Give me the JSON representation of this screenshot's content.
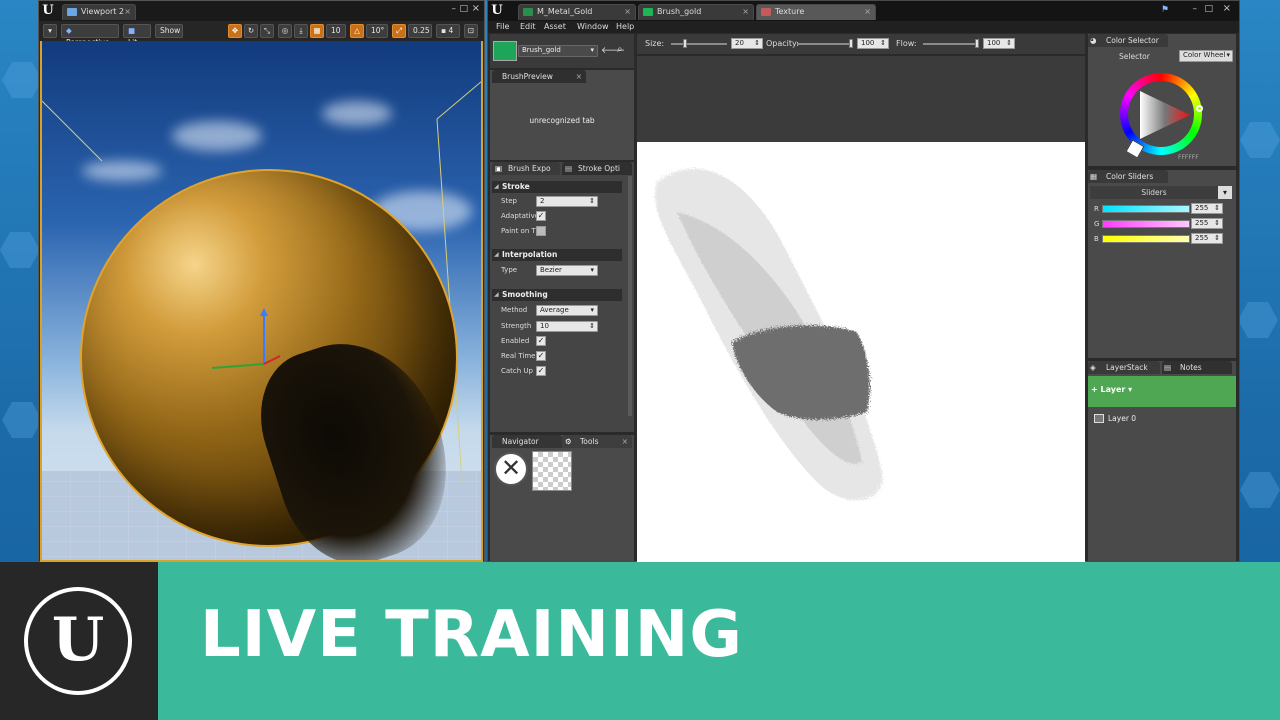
{
  "viewport_window": {
    "tab_title": "Viewport 2",
    "toolbar": {
      "perspective": "Perspective",
      "lit": "Lit",
      "show": "Show",
      "grid_snap": "10",
      "rotation_snap": "10°",
      "scale_snap": "0.25",
      "camera_speed": "4"
    }
  },
  "editor_window": {
    "tabs": [
      {
        "label": "M_Metal_Gold"
      },
      {
        "label": "Brush_gold"
      },
      {
        "label": "Texture"
      }
    ],
    "menu": [
      "File",
      "Edit",
      "Asset",
      "Window",
      "Help"
    ],
    "brush_selector": {
      "value": "Brush_gold"
    },
    "brush_preview": {
      "tab": "BrushPreview",
      "content": "unrecognized tab"
    },
    "details": {
      "tabs": [
        "Brush Expo",
        "Stroke Opti"
      ],
      "sections": {
        "stroke": {
          "title": "Stroke",
          "step_label": "Step",
          "step_value": "2",
          "adaptative_label": "Adaptative",
          "paint_on_label": "Paint on T"
        },
        "interpolation": {
          "title": "Interpolation",
          "type_label": "Type",
          "type_value": "Bezier"
        },
        "smoothing": {
          "title": "Smoothing",
          "method_label": "Method",
          "method_value": "Average",
          "strength_label": "Strength",
          "strength_value": "10",
          "enabled_label": "Enabled",
          "realtime_label": "Real Time",
          "catchup_label": "Catch Up"
        }
      }
    },
    "bottom_tabs": {
      "navigator": "Navigator",
      "tools": "Tools"
    },
    "brush_settings": {
      "size_label": "Size:",
      "size_value": "20",
      "opacity_label": "Opacity:",
      "opacity_value": "100",
      "flow_label": "Flow:",
      "flow_value": "100"
    },
    "color_selector": {
      "tab": "Color Selector",
      "selector_label": "Selector",
      "mode": "Color Wheel",
      "hex": "FFFFFF"
    },
    "color_sliders": {
      "tab": "Color Sliders",
      "mode": "Sliders",
      "channels": [
        {
          "name": "R",
          "value": "255",
          "color": "#00e5ff"
        },
        {
          "name": "G",
          "value": "255",
          "color": "#ff3cff"
        },
        {
          "name": "B",
          "value": "255",
          "color": "#ffff00"
        }
      ]
    },
    "layers": {
      "tabs": [
        "LayerStack",
        "Notes"
      ],
      "add_layer": "Layer",
      "items": [
        "Layer 0"
      ]
    }
  },
  "banner": {
    "title": "LIVE TRAINING",
    "accent_color": "#3ab99b"
  }
}
